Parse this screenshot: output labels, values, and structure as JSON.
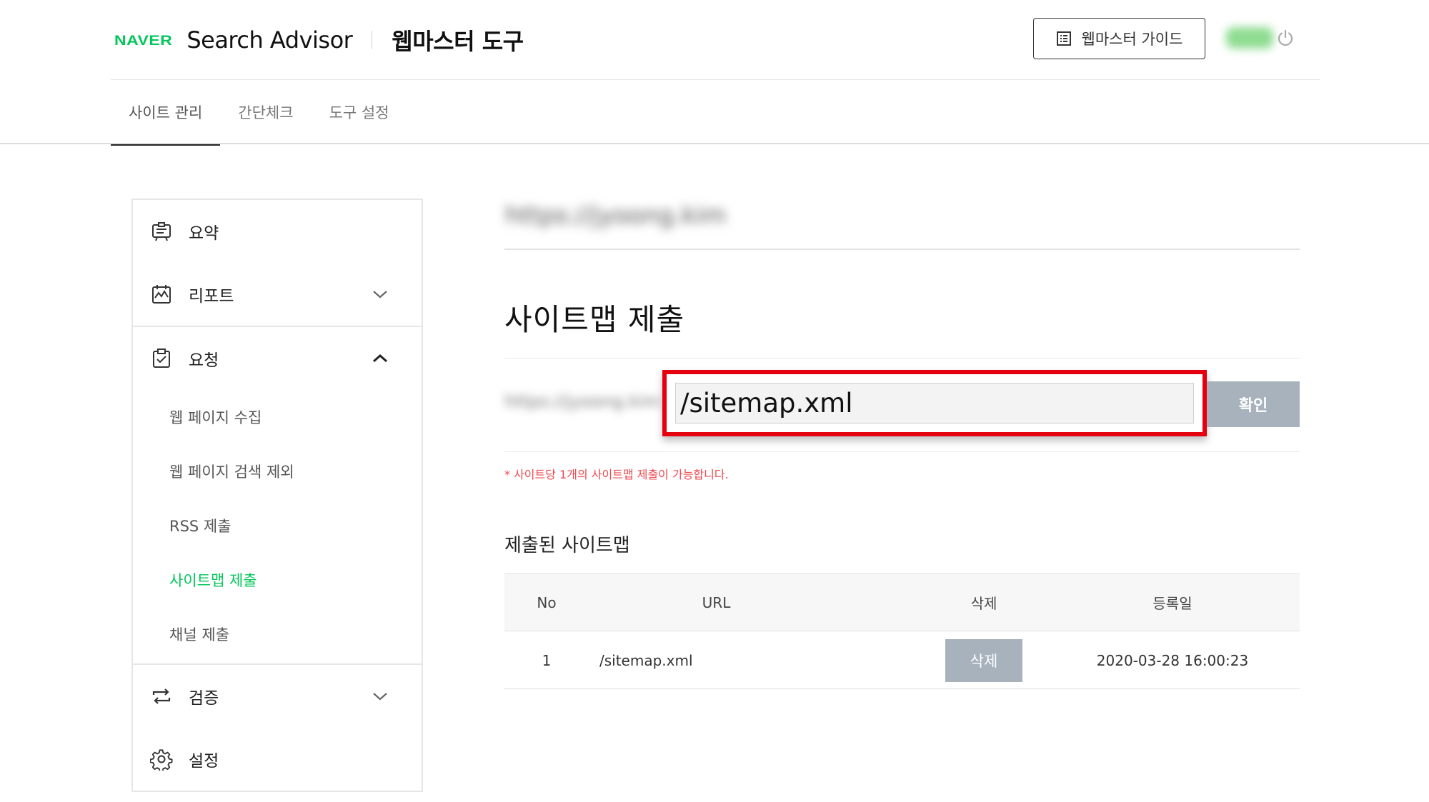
{
  "header": {
    "naver_logo": "NAVER",
    "product": "Search Advisor",
    "tool_title": "웹마스터 도구",
    "guide_button": "웹마스터 가이드",
    "guide_icon": "list-doc-icon",
    "power_icon": "power-icon"
  },
  "tabs": [
    {
      "label": "사이트 관리",
      "active": true
    },
    {
      "label": "간단체크",
      "active": false
    },
    {
      "label": "도구 설정",
      "active": false
    }
  ],
  "sidebar": {
    "items": [
      {
        "label": "요약",
        "icon": "summary-icon"
      },
      {
        "label": "리포트",
        "icon": "report-icon",
        "expanded": false
      },
      {
        "label": "요청",
        "icon": "request-icon",
        "expanded": true
      },
      {
        "label": "검증",
        "icon": "verify-icon",
        "expanded": false
      },
      {
        "label": "설정",
        "icon": "settings-icon"
      }
    ],
    "sub_items": [
      {
        "label": "웹 페이지 수집"
      },
      {
        "label": "웹 페이지 검색 제외"
      },
      {
        "label": "RSS 제출"
      },
      {
        "label": "사이트맵 제출",
        "active": true
      },
      {
        "label": "채널 제출"
      }
    ]
  },
  "main": {
    "site_url": "https://jyoong.kim",
    "page_title": "사이트맵 제출",
    "url_prefix": "https://jyoong.kim",
    "sitemap_input_value": "/sitemap.xml",
    "confirm_button": "확인",
    "notice": "* 사이트당 1개의 사이트맵 제출이 가능합니다.",
    "submitted_title": "제출된 사이트맵",
    "table": {
      "headers": [
        "No",
        "URL",
        "삭제",
        "등록일"
      ],
      "rows": [
        {
          "no": "1",
          "url": "/sitemap.xml",
          "delete_label": "삭제",
          "date": "2020-03-28 16:00:23"
        }
      ]
    }
  },
  "colors": {
    "brand_green": "#03c75a",
    "highlight_red": "#e4000f",
    "button_gray": "#a7b2bd",
    "notice_red": "#f0484f"
  }
}
